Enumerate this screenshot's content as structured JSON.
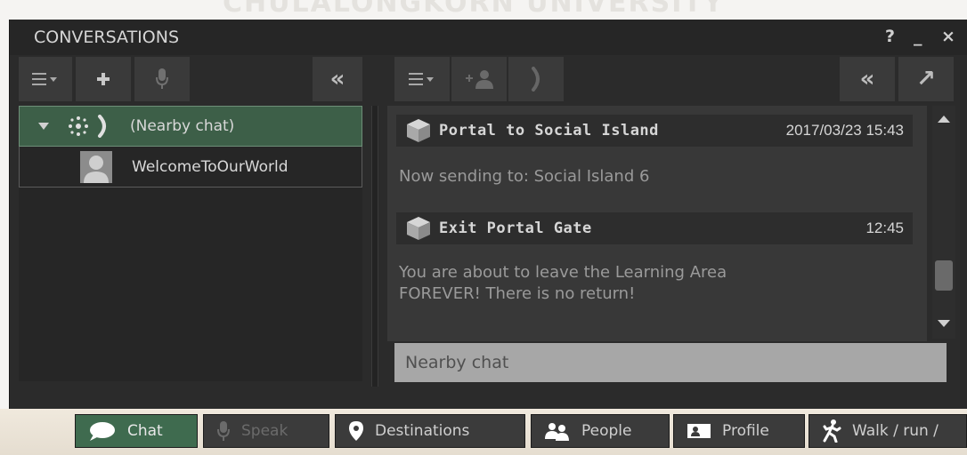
{
  "watermark": "CHULALONGKORN UNIVERSITY",
  "window": {
    "title": "CONVERSATIONS",
    "controls": {
      "help": "?",
      "minimize": "_",
      "close": "×"
    }
  },
  "left_toolbar": {
    "buttons": [
      {
        "icon": "list-menu-icon"
      },
      {
        "icon": "plus-icon"
      },
      {
        "icon": "microphone-icon"
      },
      {
        "icon": "collapse-icon",
        "label": "«"
      }
    ]
  },
  "right_toolbar": {
    "buttons": [
      {
        "icon": "list-menu-icon"
      },
      {
        "icon": "add-person-icon"
      },
      {
        "icon": "call-icon"
      },
      {
        "icon": "collapse-icon",
        "label": "«"
      },
      {
        "icon": "expand-icon",
        "label": "↗"
      }
    ]
  },
  "conversations": [
    {
      "label": "(Nearby chat)",
      "selected": true
    },
    {
      "label": "WelcomeToOurWorld",
      "selected": false
    }
  ],
  "messages": [
    {
      "name": "Portal to Social Island",
      "time": "2017/03/23 15:43",
      "text": "Now sending to: Social Island 6"
    },
    {
      "name": "Exit Portal Gate",
      "time": "12:45",
      "text_lines": [
        "You are about to leave the Learning Area",
        "FOREVER!  There is no return!"
      ]
    }
  ],
  "input": {
    "placeholder": "Nearby chat",
    "value": ""
  },
  "bottom_bar": {
    "buttons": [
      {
        "label": "Chat",
        "icon": "speech-bubble-icon",
        "state": "active"
      },
      {
        "label": "Speak",
        "icon": "microphone-icon",
        "state": "disabled"
      },
      {
        "label": "Destinations",
        "icon": "map-pin-icon",
        "state": "normal"
      },
      {
        "label": "People",
        "icon": "people-icon",
        "state": "normal"
      },
      {
        "label": "Profile",
        "icon": "profile-card-icon",
        "state": "normal"
      },
      {
        "label": "Walk / run /",
        "icon": "walking-person-icon",
        "state": "normal"
      }
    ]
  },
  "colors": {
    "selected_row": "#3d5f48",
    "active_button": "#3f6b4f",
    "panel_bg": "#2b2b2b",
    "chat_bg": "#383838"
  }
}
